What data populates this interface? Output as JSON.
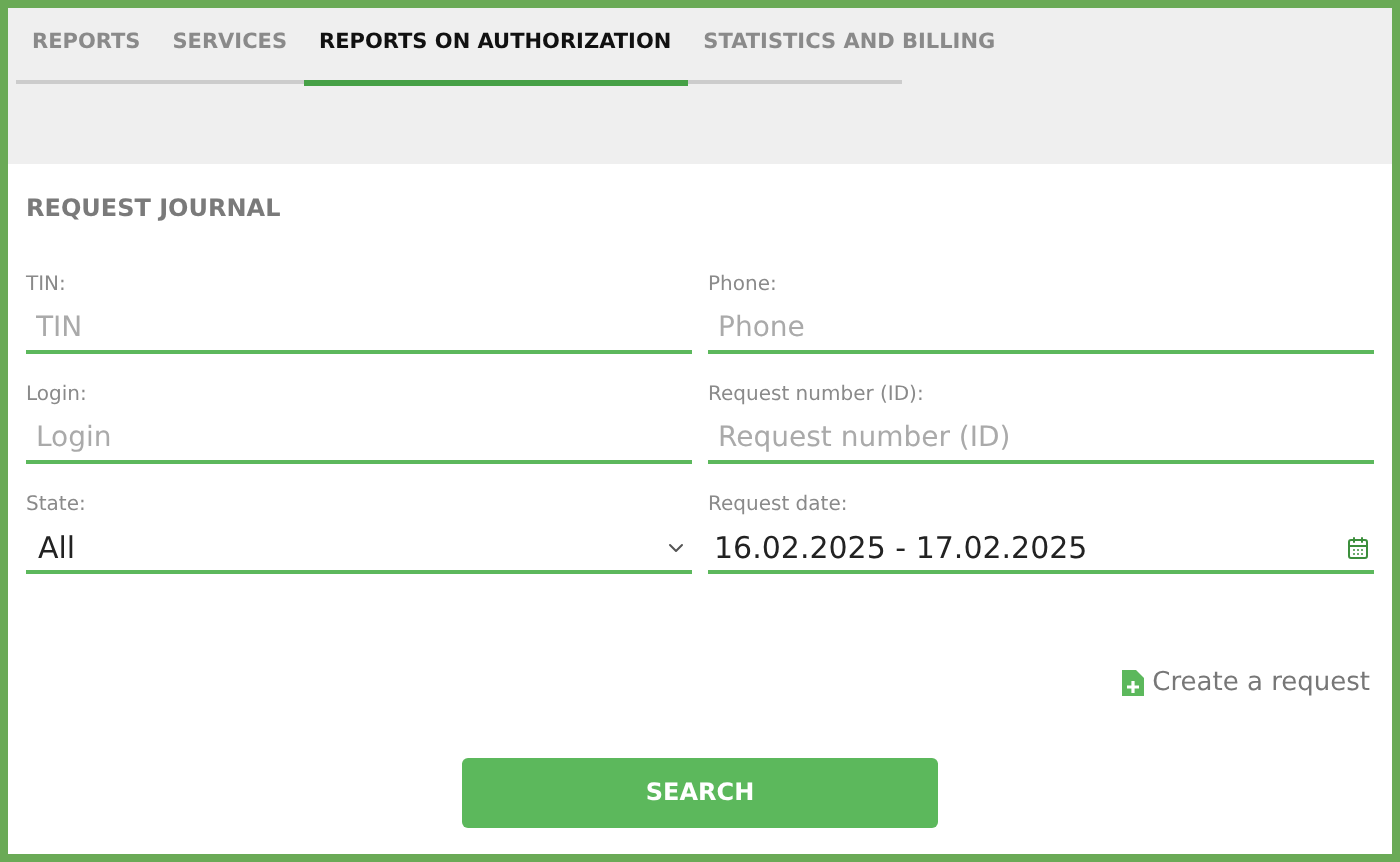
{
  "tabs": [
    {
      "label": "REPORTS",
      "selected": false
    },
    {
      "label": "SERVICES",
      "selected": false
    },
    {
      "label": "REPORTS ON AUTHORIZATION",
      "selected": true
    },
    {
      "label": "STATISTICS AND BILLING",
      "selected": false
    }
  ],
  "section_title": "REQUEST JOURNAL",
  "fields": [
    {
      "kind": "text",
      "label": "TIN:",
      "placeholder": "TIN"
    },
    {
      "kind": "text",
      "label": "Phone:",
      "placeholder": "Phone"
    },
    {
      "kind": "text",
      "label": "Login:",
      "placeholder": "Login"
    },
    {
      "kind": "text",
      "label": "Request number (ID):",
      "placeholder": "Request number (ID)"
    },
    {
      "kind": "select",
      "label": "State:",
      "value": "All"
    },
    {
      "kind": "date",
      "label": "Request date:",
      "value": "16.02.2025 - 17.02.2025"
    }
  ],
  "create_link": "Create a request",
  "search_button": "SEARCH"
}
